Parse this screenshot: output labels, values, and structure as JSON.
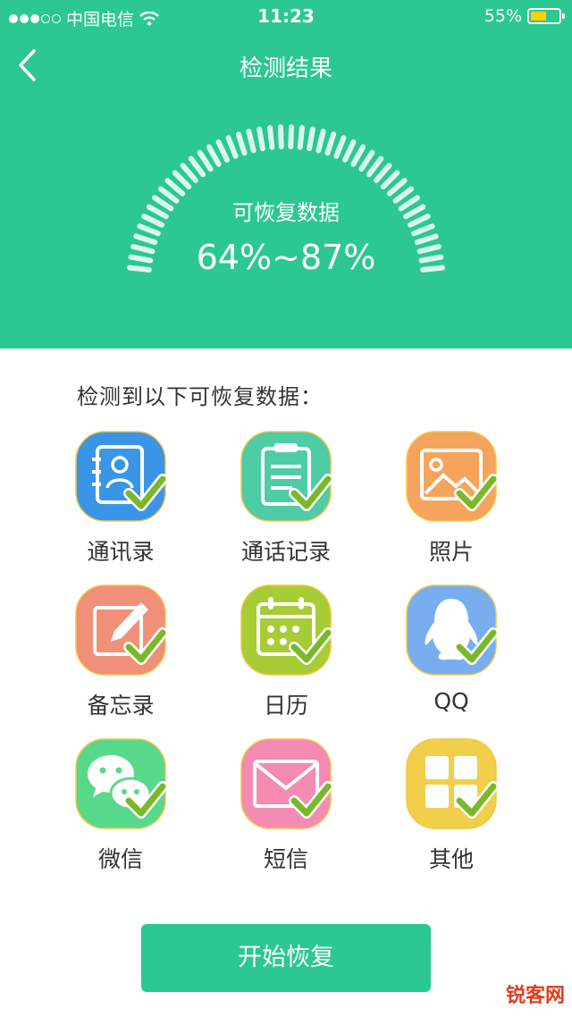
{
  "status_bar": {
    "carrier": "中国电信",
    "time": "11:23",
    "battery_percent": "55%",
    "battery_level": 0.55
  },
  "nav": {
    "title": "检测结果"
  },
  "gauge": {
    "label": "可恢复数据",
    "value": "64%~87%"
  },
  "section_title": "检测到以下可恢复数据：",
  "items": [
    {
      "label": "通讯录",
      "icon": "contacts-icon",
      "color": "#3a95e6"
    },
    {
      "label": "通话记录",
      "icon": "clipboard-icon",
      "color": "#4dcca6"
    },
    {
      "label": "照片",
      "icon": "image-icon",
      "color": "#f5a45e"
    },
    {
      "label": "备忘录",
      "icon": "memo-icon",
      "color": "#f09078"
    },
    {
      "label": "日历",
      "icon": "calendar-icon",
      "color": "#a7cc36"
    },
    {
      "label": "QQ",
      "icon": "penguin-icon",
      "color": "#78aef0"
    },
    {
      "label": "微信",
      "icon": "chat-icon",
      "color": "#58d88a"
    },
    {
      "label": "短信",
      "icon": "envelope-icon",
      "color": "#f38bb2"
    },
    {
      "label": "其他",
      "icon": "grid-icon",
      "color": "#f2cf4a"
    }
  ],
  "button": {
    "label": "开始恢复"
  },
  "watermark": "锐客网",
  "colors": {
    "primary": "#2cc793",
    "check": "#7ab829"
  }
}
